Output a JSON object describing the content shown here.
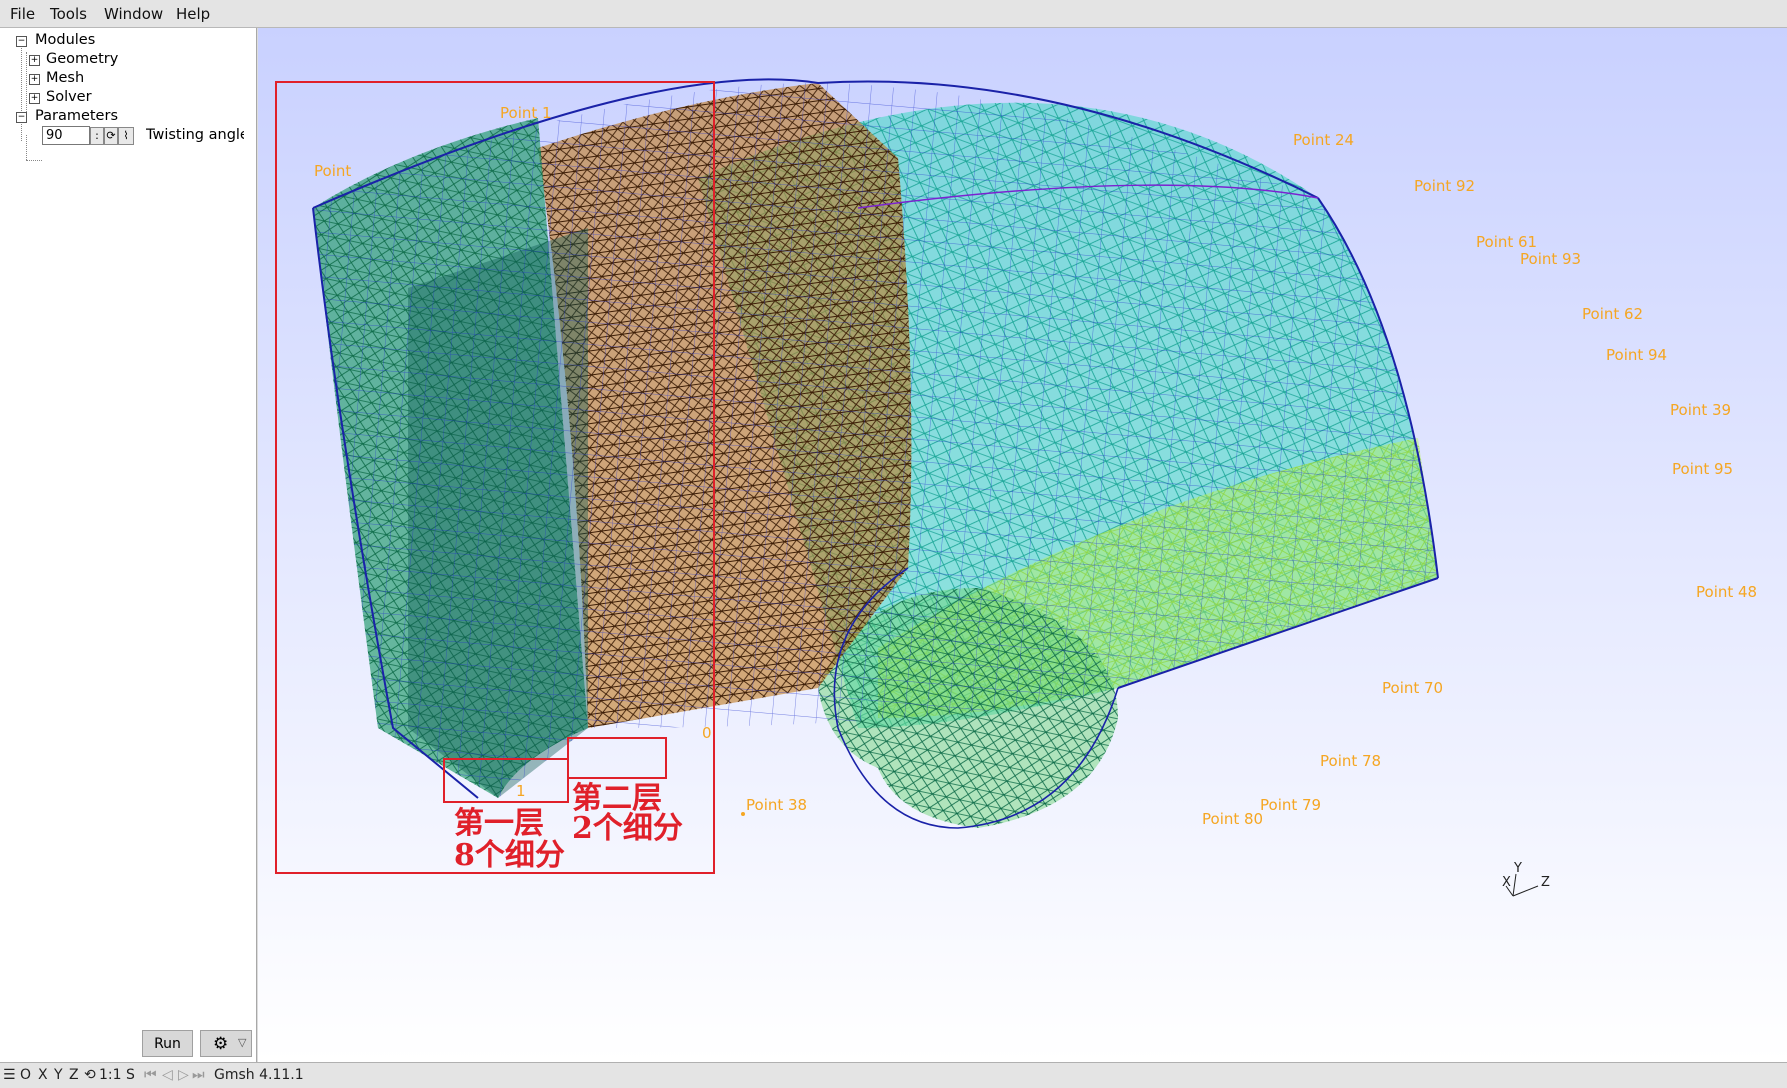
{
  "menu": {
    "file": "File",
    "tools": "Tools",
    "window": "Window",
    "help": "Help"
  },
  "tree": {
    "modules": "Modules",
    "geometry": "Geometry",
    "mesh": "Mesh",
    "solver": "Solver",
    "parameters": "Parameters",
    "param_value": "90",
    "param_label": "Twisting angle"
  },
  "run_label": "Run",
  "points": {
    "p24": "Point 24",
    "p92": "Point 92",
    "p61": "Point 61",
    "p93": "Point 93",
    "p62": "Point 62",
    "p94": "Point 94",
    "p39": "Point 39",
    "p95": "Point 95",
    "p48": "Point 48",
    "p78": "Point 78",
    "p79": "Point 79",
    "p38": "Point 38",
    "p_top": "Point 1",
    "p_left": "Point",
    "p_70": "Point 70",
    "p_80": "Point 80",
    "small_1": "1",
    "small_0": "0"
  },
  "annotations": {
    "layer1_line1": "第一层",
    "layer1_line2": "8个细分",
    "layer2_line1": "第二层",
    "layer2_line2": "2个细分"
  },
  "axes": {
    "y": "Y",
    "x": "X",
    "z": "Z"
  },
  "status": {
    "o": "O",
    "x": "X",
    "y": "Y",
    "z": "Z",
    "scale": "1:1",
    "s": "S",
    "version": "Gmsh 4.11.1"
  },
  "colors": {
    "annotation_red": "#e0202a",
    "point_label": "#f5a623",
    "mesh_green": "#1e9a6a",
    "mesh_brown": "#6b3a10",
    "mesh_blue": "#2233cc",
    "mesh_cyan": "#33e0c8"
  }
}
